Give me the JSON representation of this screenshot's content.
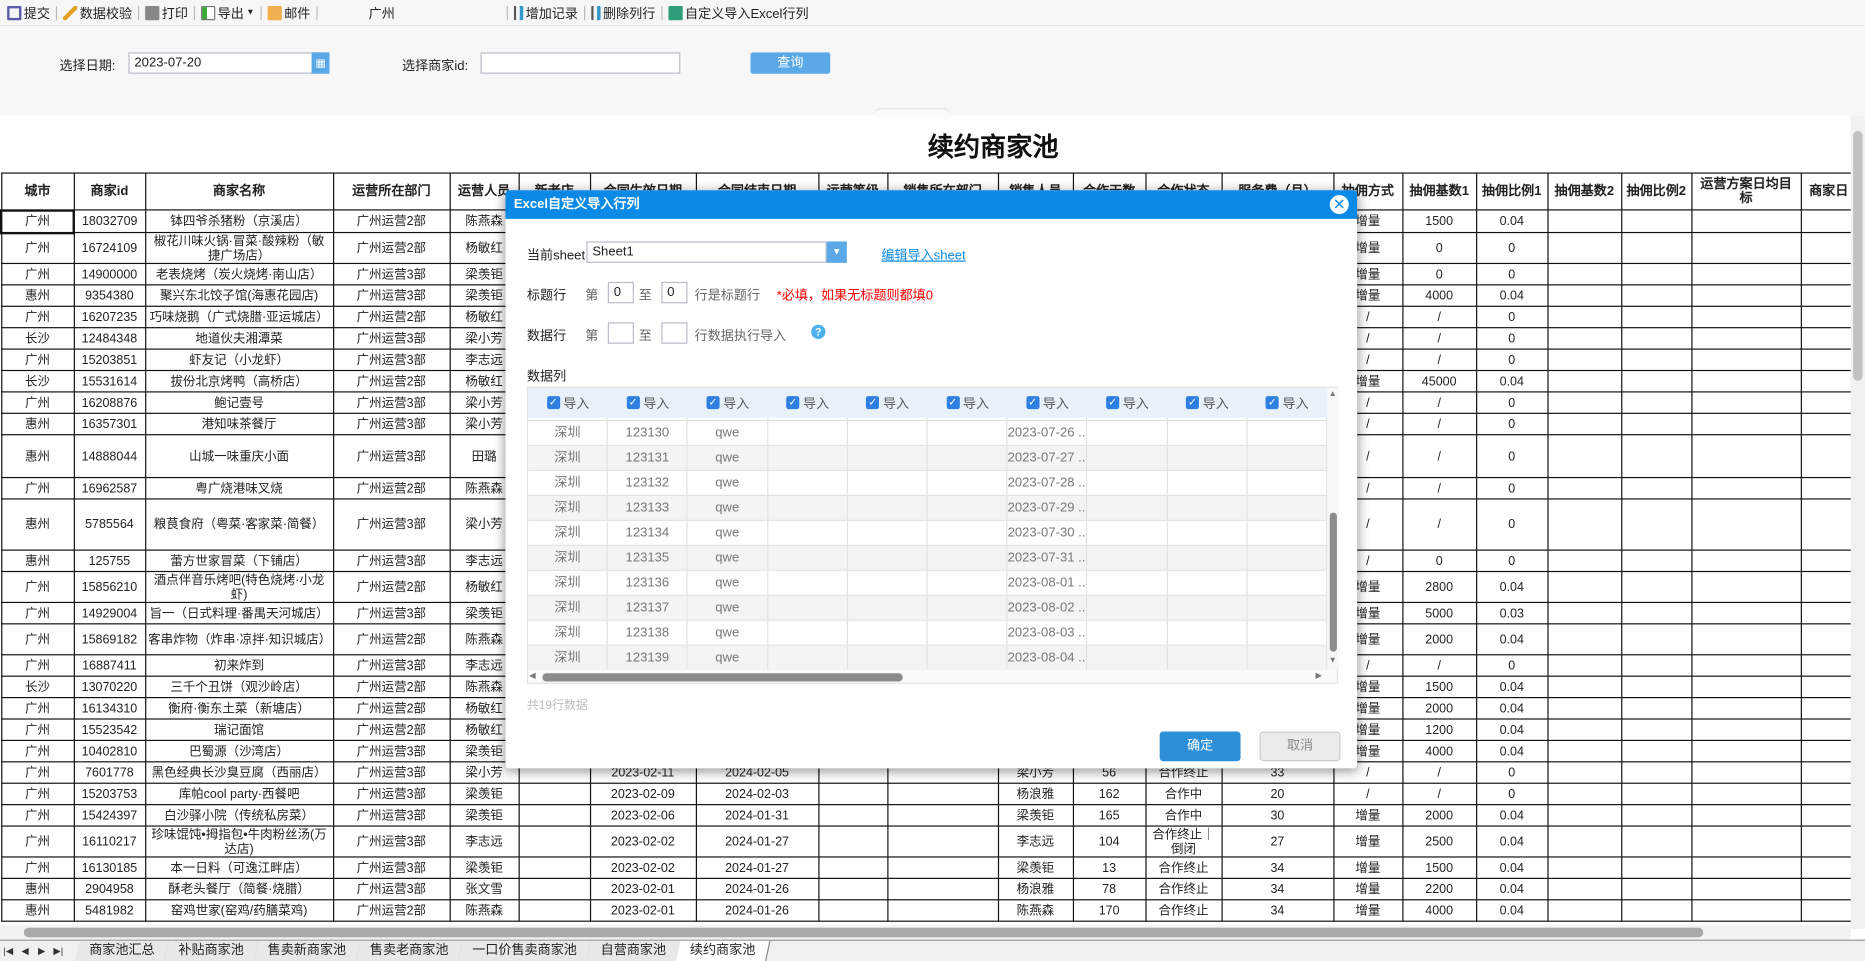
{
  "toolbar": {
    "submit": "提交",
    "validate": "数据校验",
    "print": "打印",
    "export": "导出",
    "mail": "邮件",
    "city": "广州",
    "add_record": "增加记录",
    "delete_row_col": "删除列行",
    "custom_import": "自定义导入Excel行列"
  },
  "form": {
    "date_label": "选择日期:",
    "date_value": "2023-07-20",
    "merchant_label": "选择商家id:",
    "merchant_value": "",
    "query": "查询"
  },
  "report_title": "续约商家池",
  "table": {
    "headers": [
      "城市",
      "商家id",
      "商家名称",
      "运营所在部门",
      "运营人员",
      "新老店",
      "合同生效日期",
      "合同结束日期",
      "运营等级",
      "销售所在部门",
      "销售人员",
      "合作天数",
      "合作状态",
      "服务费（月）",
      "抽佣方式",
      "抽佣基数1",
      "抽佣比例1",
      "抽佣基数2",
      "抽佣比例2",
      "运营方案日均目标",
      "商家日"
    ],
    "rows": [
      [
        "广州",
        "18032709",
        "钵四爷杀猪粉（京溪店）",
        "广州运营2部",
        "陈燕森",
        "",
        "",
        "",
        "",
        "",
        "",
        "",
        "",
        "",
        "增量",
        "1500",
        "0.04",
        "",
        "",
        "",
        ""
      ],
      [
        "广州",
        "16724109",
        "椒花川味火锅·冒菜·酸辣粉（敏捷广场店）",
        "广州运营2部",
        "杨敏红",
        "",
        "",
        "",
        "",
        "",
        "",
        "",
        "",
        "",
        "增量",
        "0",
        "0",
        "",
        "",
        "",
        ""
      ],
      [
        "广州",
        "14900000",
        "老表烧烤（炭火烧烤·南山店）",
        "广州运营3部",
        "梁羡钜",
        "",
        "",
        "",
        "",
        "",
        "",
        "",
        "",
        "",
        "增量",
        "0",
        "0",
        "",
        "",
        "",
        ""
      ],
      [
        "惠州",
        "9354380",
        "聚兴东北饺子馆(海惠花园店)",
        "广州运营3部",
        "梁羡钜",
        "",
        "",
        "",
        "",
        "",
        "",
        "",
        "",
        "",
        "增量",
        "4000",
        "0.04",
        "",
        "",
        "",
        ""
      ],
      [
        "广州",
        "16207235",
        "巧味烧鹅（广式烧腊·亚运城店）",
        "广州运营2部",
        "杨敏红",
        "",
        "",
        "",
        "",
        "",
        "",
        "",
        "",
        "",
        "/",
        "/",
        "0",
        "",
        "",
        "",
        ""
      ],
      [
        "长沙",
        "12484348",
        "地道伙夫湘潭菜",
        "广州运营3部",
        "梁小芳",
        "",
        "",
        "",
        "",
        "",
        "",
        "",
        "",
        "",
        "/",
        "/",
        "0",
        "",
        "",
        "",
        ""
      ],
      [
        "广州",
        "15203851",
        "虾友记（小龙虾）",
        "广州运营3部",
        "李志远",
        "",
        "",
        "",
        "",
        "",
        "",
        "",
        "",
        "",
        "/",
        "/",
        "0",
        "",
        "",
        "",
        ""
      ],
      [
        "长沙",
        "15531614",
        "拔份北京烤鸭（高桥店）",
        "广州运营2部",
        "杨敏红",
        "",
        "",
        "",
        "",
        "",
        "",
        "",
        "",
        "",
        "增量",
        "45000",
        "0.04",
        "",
        "",
        "",
        ""
      ],
      [
        "广州",
        "16208876",
        "鲍记壹号",
        "广州运营3部",
        "梁小芳",
        "",
        "",
        "",
        "",
        "",
        "",
        "",
        "",
        "",
        "/",
        "/",
        "0",
        "",
        "",
        "",
        ""
      ],
      [
        "惠州",
        "16357301",
        "港知味茶餐厅",
        "广州运营3部",
        "梁小芳",
        "",
        "",
        "",
        "",
        "",
        "",
        "",
        "",
        "",
        "/",
        "/",
        "0",
        "",
        "",
        "",
        ""
      ],
      [
        "惠州",
        "14888044",
        "山城一味重庆小面",
        "广州运营3部",
        "田璐",
        "",
        "",
        "",
        "",
        "",
        "",
        "",
        "",
        "",
        "/",
        "/",
        "0",
        "",
        "",
        "",
        ""
      ],
      [
        "广州",
        "16962587",
        "粤广烧港味叉烧",
        "广州运营2部",
        "陈燕森",
        "",
        "",
        "",
        "",
        "",
        "",
        "",
        "",
        "",
        "/",
        "/",
        "0",
        "",
        "",
        "",
        ""
      ],
      [
        "惠州",
        "5785564",
        "粮茛食府（粤菜·客家菜·简餐）",
        "广州运营3部",
        "梁小芳",
        "",
        "",
        "",
        "",
        "",
        "",
        "",
        "",
        "",
        "/",
        "/",
        "0",
        "",
        "",
        "",
        ""
      ],
      [
        "惠州",
        "125755",
        "蕾方世家冒菜（下铺店）",
        "广州运营3部",
        "李志远",
        "",
        "",
        "",
        "",
        "",
        "",
        "",
        "",
        "",
        "/",
        "0",
        "0",
        "",
        "",
        "",
        ""
      ],
      [
        "广州",
        "15856210",
        "酒点伴音乐烤吧(特色烧烤·小龙虾)",
        "广州运营2部",
        "杨敏红",
        "",
        "",
        "",
        "",
        "",
        "",
        "",
        "",
        "",
        "增量",
        "2800",
        "0.04",
        "",
        "",
        "",
        ""
      ],
      [
        "广州",
        "14929004",
        "旨一（日式料理·番禺天河城店）",
        "广州运营3部",
        "梁羡钜",
        "",
        "",
        "",
        "",
        "",
        "",
        "",
        "",
        "",
        "增量",
        "5000",
        "0.03",
        "",
        "",
        "",
        ""
      ],
      [
        "广州",
        "15869182",
        "客串炸物（炸串·凉拌·知识城店）",
        "广州运营2部",
        "陈燕森",
        "",
        "",
        "",
        "",
        "",
        "",
        "",
        "",
        "",
        "增量",
        "2000",
        "0.04",
        "",
        "",
        "",
        ""
      ],
      [
        "广州",
        "16887411",
        "初来炸到",
        "广州运营3部",
        "李志远",
        "",
        "",
        "",
        "",
        "",
        "",
        "",
        "",
        "",
        "/",
        "/",
        "0",
        "",
        "",
        "",
        ""
      ],
      [
        "长沙",
        "13070220",
        "三千个丑饼（观沙岭店）",
        "广州运营2部",
        "陈燕森",
        "",
        "",
        "",
        "",
        "",
        "",
        "",
        "",
        "",
        "增量",
        "1500",
        "0.04",
        "",
        "",
        "",
        ""
      ],
      [
        "广州",
        "16134310",
        "衡府·衡东土菜（新塘店）",
        "广州运营2部",
        "杨敏红",
        "",
        "",
        "",
        "",
        "",
        "",
        "",
        "",
        "",
        "增量",
        "2000",
        "0.04",
        "",
        "",
        "",
        ""
      ],
      [
        "广州",
        "15523542",
        "瑞记面馆",
        "广州运营2部",
        "杨敏红",
        "",
        "",
        "",
        "",
        "",
        "",
        "",
        "",
        "",
        "增量",
        "1200",
        "0.04",
        "",
        "",
        "",
        ""
      ],
      [
        "广州",
        "10402810",
        "巴蜀源（沙湾店）",
        "广州运营3部",
        "梁羡钜",
        "",
        "",
        "",
        "",
        "",
        "",
        "",
        "",
        "",
        "增量",
        "4000",
        "0.04",
        "",
        "",
        "",
        ""
      ],
      [
        "广州",
        "7601778",
        "黑色经典长沙臭豆腐（西丽店）",
        "广州运营3部",
        "梁小芳",
        "",
        "2023-02-11",
        "2024-02-05",
        "",
        "",
        "梁小芳",
        "56",
        "合作终止",
        "33",
        "/",
        "/",
        "0",
        "",
        "",
        "",
        ""
      ],
      [
        "广州",
        "15203753",
        "库帕cool party·西餐吧",
        "广州运营3部",
        "梁羡钜",
        "",
        "2023-02-09",
        "2024-02-03",
        "",
        "",
        "杨浪雅",
        "162",
        "合作中",
        "20",
        "/",
        "/",
        "0",
        "",
        "",
        "",
        ""
      ],
      [
        "广州",
        "15424397",
        "白沙驿小院（传统私房菜）",
        "广州运营3部",
        "梁羡钜",
        "",
        "2023-02-06",
        "2024-01-31",
        "",
        "",
        "梁羡钜",
        "165",
        "合作中",
        "30",
        "增量",
        "2000",
        "0.04",
        "",
        "",
        "",
        ""
      ],
      [
        "广州",
        "16110217",
        "珍味馄饨•拇指包•牛肉粉丝汤(万达店)",
        "广州运营3部",
        "李志远",
        "",
        "2023-02-02",
        "2024-01-27",
        "",
        "",
        "李志远",
        "104",
        "合作终止｜倒闭",
        "27",
        "增量",
        "2500",
        "0.04",
        "",
        "",
        "",
        ""
      ],
      [
        "广州",
        "16130185",
        "本一日料（可逸江畔店）",
        "广州运营3部",
        "梁羡钜",
        "",
        "2023-02-02",
        "2024-01-27",
        "",
        "",
        "梁羡钜",
        "13",
        "合作终止",
        "34",
        "增量",
        "1500",
        "0.04",
        "",
        "",
        "",
        ""
      ],
      [
        "惠州",
        "2904958",
        "酥老头餐厅（简餐·烧腊）",
        "广州运营3部",
        "张文雪",
        "",
        "2023-02-01",
        "2024-01-26",
        "",
        "",
        "杨浪雅",
        "78",
        "合作终止",
        "34",
        "增量",
        "2200",
        "0.04",
        "",
        "",
        "",
        ""
      ],
      [
        "惠州",
        "5481982",
        "窑鸡世家(窑鸡/药膳菜鸡)",
        "广州运营2部",
        "陈燕森",
        "",
        "2023-02-01",
        "2024-01-26",
        "",
        "",
        "陈燕森",
        "170",
        "合作终止",
        "34",
        "增量",
        "4000",
        "0.04",
        "",
        "",
        "",
        ""
      ]
    ]
  },
  "dialog": {
    "title": "Excel自定义导入行列",
    "sheet_label": "当前sheet",
    "sheet_value": "Sheet1",
    "edit_sheet_link": "编辑导入sheet",
    "title_row_label": "标题行",
    "di": "第",
    "zhi": "至",
    "title_from": "0",
    "title_to": "0",
    "title_suffix": "行是标题行",
    "title_hint": "*必填，如果无标题则都填0",
    "data_row_label": "数据行",
    "data_from": "",
    "data_to": "",
    "data_suffix": "行数据执行导入",
    "data_col_label": "数据列",
    "import_label": "导入",
    "grid_rows": [
      [
        "深圳",
        "123130",
        "qwe",
        "2023-07-26 ..."
      ],
      [
        "深圳",
        "123131",
        "qwe",
        "2023-07-27 ..."
      ],
      [
        "深圳",
        "123132",
        "qwe",
        "2023-07-28 ..."
      ],
      [
        "深圳",
        "123133",
        "qwe",
        "2023-07-29 ..."
      ],
      [
        "深圳",
        "123134",
        "qwe",
        "2023-07-30 ..."
      ],
      [
        "深圳",
        "123135",
        "qwe",
        "2023-07-31 ..."
      ],
      [
        "深圳",
        "123136",
        "qwe",
        "2023-08-01 ..."
      ],
      [
        "深圳",
        "123137",
        "qwe",
        "2023-08-02 ..."
      ],
      [
        "深圳",
        "123138",
        "qwe",
        "2023-08-03 ..."
      ],
      [
        "深圳",
        "123139",
        "qwe",
        "2023-08-04 ..."
      ]
    ],
    "row_count": "共19行数据",
    "ok": "确定",
    "cancel": "取消"
  },
  "sheet_tabs": [
    "商家池汇总",
    "补贴商家池",
    "售卖新商家池",
    "售卖老商家池",
    "一口价售卖商家池",
    "自营商家池",
    "续约商家池"
  ],
  "active_tab": "续约商家池",
  "colors": {
    "accent": "#0a8ae6",
    "query": "#5aa9e6",
    "error": "#ff0000"
  }
}
